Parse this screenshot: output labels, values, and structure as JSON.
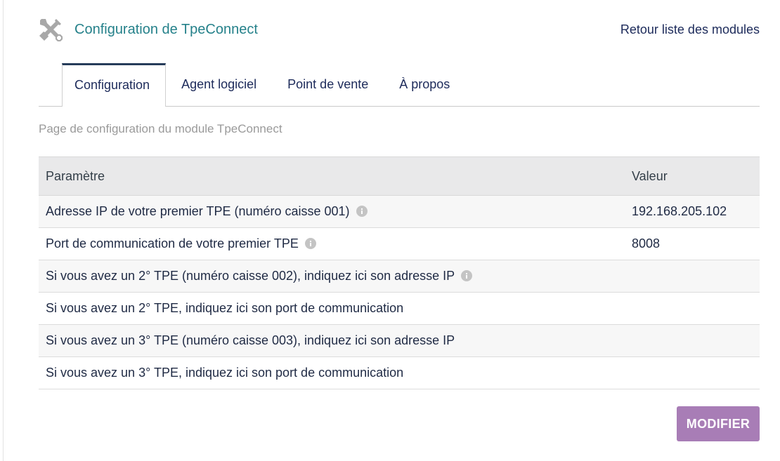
{
  "header": {
    "icon": "tools-icon",
    "title": "Configuration de TpeConnect",
    "back_link": "Retour liste des modules"
  },
  "tabs": [
    {
      "label": "Configuration",
      "active": true
    },
    {
      "label": "Agent logiciel",
      "active": false
    },
    {
      "label": "Point de vente",
      "active": false
    },
    {
      "label": "À propos",
      "active": false
    }
  ],
  "subtitle": "Page de configuration du module TpeConnect",
  "table": {
    "headers": {
      "param": "Paramètre",
      "value": "Valeur"
    },
    "rows": [
      {
        "label": "Adresse IP de votre premier TPE (numéro caisse 001)",
        "value": "192.168.205.102",
        "info": true
      },
      {
        "label": "Port de communication de votre premier TPE",
        "value": "8008",
        "info": true
      },
      {
        "label": "Si vous avez un 2° TPE (numéro caisse 002), indiquez ici son adresse IP",
        "value": "",
        "info": true
      },
      {
        "label": "Si vous avez un 2° TPE, indiquez ici son port de communication",
        "value": "",
        "info": false
      },
      {
        "label": "Si vous avez un 3° TPE (numéro caisse 003), indiquez ici son adresse IP",
        "value": "",
        "info": false
      },
      {
        "label": "Si vous avez un 3° TPE, indiquez ici son port de communication",
        "value": "",
        "info": false
      }
    ]
  },
  "actions": {
    "modify_label": "MODIFIER"
  },
  "colors": {
    "title": "#25818a",
    "link": "#1c2a5a",
    "button": "#a87db6",
    "table_header_bg": "#e9e9ea"
  }
}
